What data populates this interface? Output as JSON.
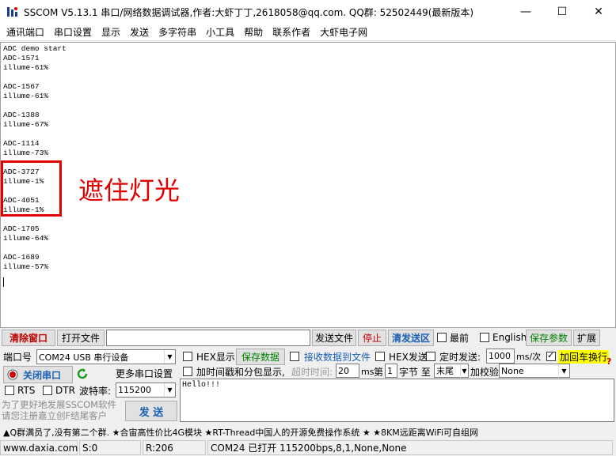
{
  "window": {
    "title": "SSCOM V5.13.1 串口/网络数据调试器,作者:大虾丁丁,2618058@qq.com. QQ群: 52502449(最新版本)",
    "minimize": "—",
    "maximize": "☐",
    "close": "✕"
  },
  "menu": [
    "通讯端口",
    "串口设置",
    "显示",
    "发送",
    "多字符串",
    "小工具",
    "帮助",
    "联系作者",
    "大虾电子网"
  ],
  "output": {
    "text": "ADC demo start\nADC-1571\nillume-61%\n\nADC-1567\nillume-61%\n\nADC-1388\nillume-67%\n\nADC-1114\nillume-73%\n\nADC-3727\nillume-1%\n\nADC-4051\nillume-1%\n\nADC-1705\nillume-64%\n\nADC-1689\nillume-57%",
    "annotation": "遮住灯光",
    "annotation_color": "#e00000"
  },
  "toolbar": {
    "clear_window": "清除窗口",
    "open_file": "打开文件",
    "file_path": "",
    "send_file": "发送文件",
    "stop": "停止",
    "clear_send": "清发送区",
    "topmost": "最前",
    "english": "English",
    "save_params": "保存参数",
    "expand": "扩展"
  },
  "port": {
    "port_label": "端口号",
    "port_value": "COM24 USB 串行设备",
    "close_port": "关闭串口",
    "more_settings": "更多串口设置",
    "rts": "RTS",
    "dtr": "DTR",
    "baud_label": "波特率:",
    "baud_value": "115200",
    "promo_line1": "为了更好地发展SSCOM软件",
    "promo_line2": "请您注册嘉立创F结尾客户",
    "send_button": "发 送"
  },
  "options": {
    "hex_display": "HEX显示",
    "save_data": "保存数据",
    "recv_to_file": "接收数据到文件",
    "hex_send": "HEX发送",
    "timed_send": "定时发送:",
    "interval_value": "1000",
    "interval_unit": "ms/次",
    "add_crlf": "加回车换行",
    "timestamp": "加时间戳和分包显示,",
    "timeout_label": "超时时间:",
    "timeout_value": "20",
    "timeout_unit": "ms",
    "byte_prefix": "第",
    "byte_from": "1",
    "byte_label": "字节 至",
    "byte_to": "末尾",
    "checksum_label": "加校验",
    "checksum_value": "None"
  },
  "send_text": "Hello!!!",
  "ticker": "▲Q群满员了,没有第二个群. ★合宙高性价比4G模块 ★RT-Thread中国人的开源免费操作系统 ★ ★8KM远距离WiFi可自组网",
  "status": {
    "website": "www.daxia.com",
    "sent": "S:0",
    "received": "R:206",
    "port_state": "COM24 已打开  115200bps,8,1,None,None"
  }
}
